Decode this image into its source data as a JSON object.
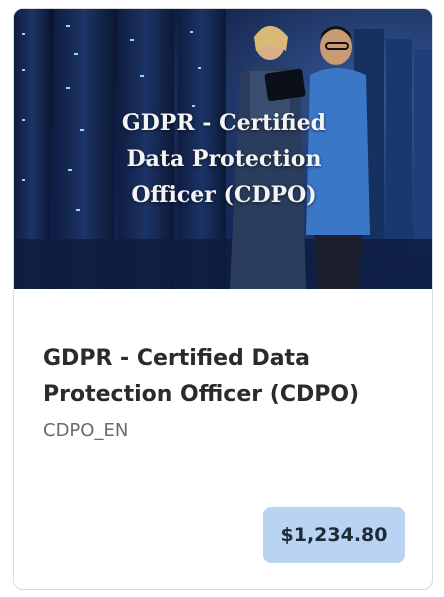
{
  "course": {
    "image_title_line1": "GDPR - Certified",
    "image_title_line2": "Data Protection",
    "image_title_line3": "Officer (CDPO)",
    "title": "GDPR - Certified Data Protection Officer (CDPO)",
    "code": "CDPO_EN",
    "price": "$1,234.80"
  },
  "colors": {
    "price_badge": "#b9d3f2",
    "title_text": "#2b2b2b",
    "code_text": "#6b6b6b"
  }
}
